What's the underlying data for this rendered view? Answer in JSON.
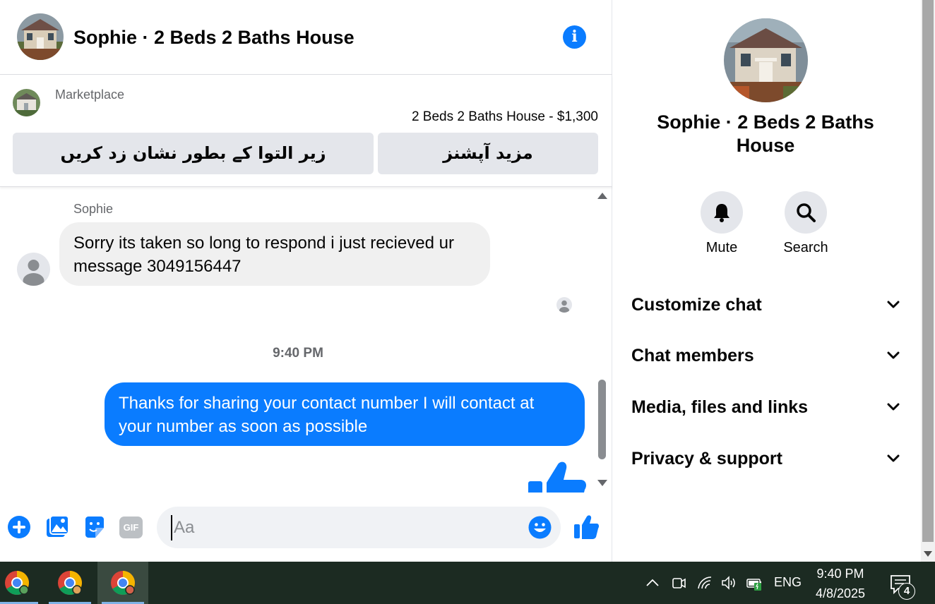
{
  "colors": {
    "accent": "#0a7cff",
    "bubble_incoming": "#f0f0f0",
    "secondary_text": "#65676b",
    "taskbar": "#1c2b22"
  },
  "header": {
    "title": "Sophie · 2 Beds 2 Baths House",
    "avatar_icon": "house-photo-icon",
    "info_icon": "info-icon"
  },
  "listing": {
    "source": "Marketplace",
    "title": "2 Beds 2 Baths House - $1,300",
    "mark_pending_label": "زیر التوا کے بطور نشان زد کریں",
    "more_options_label": "مزید آپشنز"
  },
  "conversation": {
    "sender_name": "Sophie",
    "incoming_message": "Sorry its taken so long to respond i just recieved ur message 3049156447",
    "timestamp": "9:40 PM",
    "outgoing_message": "Thanks for sharing your contact number I will contact at your number as soon as possible"
  },
  "composer": {
    "placeholder": "Aa",
    "icons": [
      "plus-icon",
      "photo-icon",
      "sticker-icon",
      "gif-icon",
      "emoji-icon",
      "thumbs-up-icon"
    ],
    "gif_label": "GIF"
  },
  "info_panel": {
    "title": "Sophie · 2 Beds 2 Baths House",
    "mute_label": "Mute",
    "search_label": "Search",
    "sections": [
      "Customize chat",
      "Chat members",
      "Media, files and links",
      "Privacy & support"
    ]
  },
  "taskbar": {
    "language": "ENG",
    "time": "9:40 PM",
    "date": "4/8/2025",
    "notification_count": "4",
    "apps": [
      "chrome-icon",
      "chrome-icon",
      "chrome-icon"
    ]
  }
}
